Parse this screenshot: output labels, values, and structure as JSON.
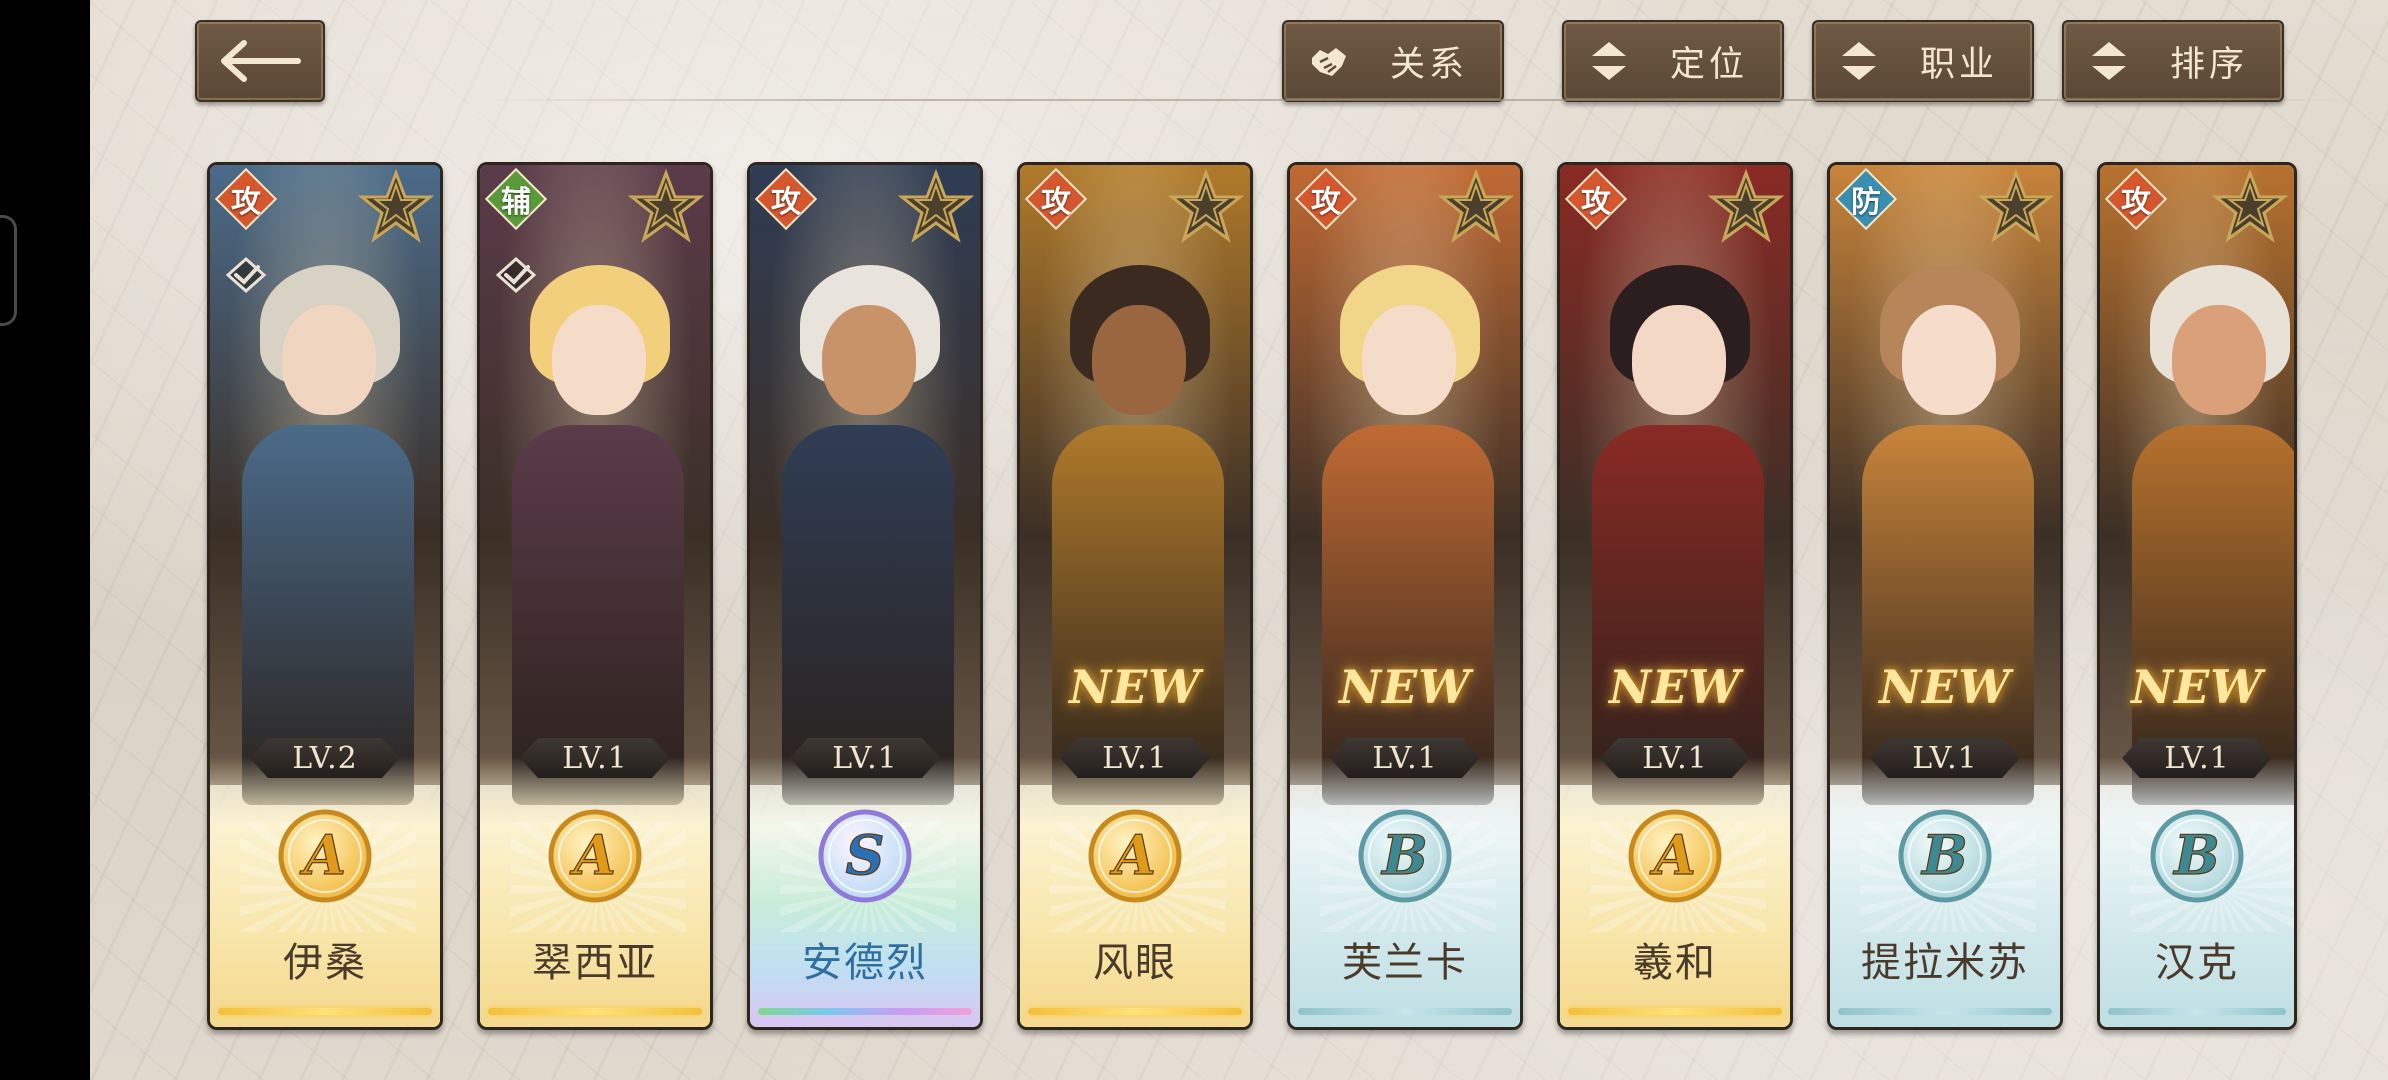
{
  "top_bar": {
    "back_icon": "arrow-left-icon",
    "filters": [
      {
        "id": "relation",
        "label": "关系",
        "icon": "handshake-icon"
      },
      {
        "id": "position",
        "label": "定位",
        "icon": "sort-arrows-icon"
      },
      {
        "id": "class",
        "label": "职业",
        "icon": "sort-arrows-icon"
      },
      {
        "id": "sort",
        "label": "排序",
        "icon": "sort-arrows-icon"
      }
    ]
  },
  "colors": {
    "attack_role": "#d4572e",
    "support_role": "#5a9a3a",
    "defense_role": "#3a8fb0",
    "plate_brown": "#5f4b39"
  },
  "characters": [
    {
      "name": "伊桑",
      "role": "攻",
      "level": "LV.2",
      "rank": "A",
      "is_new": false,
      "checked": true,
      "tint": "#4a6b8a",
      "hair": "#d8d2c4",
      "skin": "#f0d6c0"
    },
    {
      "name": "翠西亚",
      "role": "辅",
      "level": "LV.1",
      "rank": "A",
      "is_new": false,
      "checked": true,
      "tint": "#5b3b4a",
      "hair": "#f2cf7a",
      "skin": "#f5dcc8"
    },
    {
      "name": "安德烈",
      "role": "攻",
      "level": "LV.1",
      "rank": "S",
      "is_new": false,
      "checked": false,
      "tint": "#2f3d55",
      "hair": "#e8e4dc",
      "skin": "#c9936a"
    },
    {
      "name": "风眼",
      "role": "攻",
      "level": "LV.1",
      "rank": "A",
      "is_new": true,
      "new_text": "NEW",
      "checked": false,
      "tint": "#b07a2a",
      "hair": "#3a2a20",
      "skin": "#9a6640"
    },
    {
      "name": "芙兰卡",
      "role": "攻",
      "level": "LV.1",
      "rank": "B",
      "is_new": true,
      "new_text": "NEW",
      "checked": false,
      "tint": "#c06a34",
      "hair": "#f1d68a",
      "skin": "#f5dcc8"
    },
    {
      "name": "羲和",
      "role": "攻",
      "level": "LV.1",
      "rank": "A",
      "is_new": true,
      "new_text": "NEW",
      "checked": false,
      "tint": "#8a2a24",
      "hair": "#2a1e1e",
      "skin": "#f3d8c6"
    },
    {
      "name": "提拉米苏",
      "role": "防",
      "level": "LV.1",
      "rank": "B",
      "is_new": true,
      "new_text": "NEW",
      "checked": false,
      "tint": "#c8843a",
      "hair": "#b7855a",
      "skin": "#f6dccb"
    },
    {
      "name": "汉克",
      "role": "攻",
      "level": "LV.1",
      "rank": "B",
      "is_new": true,
      "new_text": "NEW",
      "checked": false,
      "tint": "#b8722e",
      "hair": "#e7e1d6",
      "skin": "#d9a07a"
    }
  ]
}
